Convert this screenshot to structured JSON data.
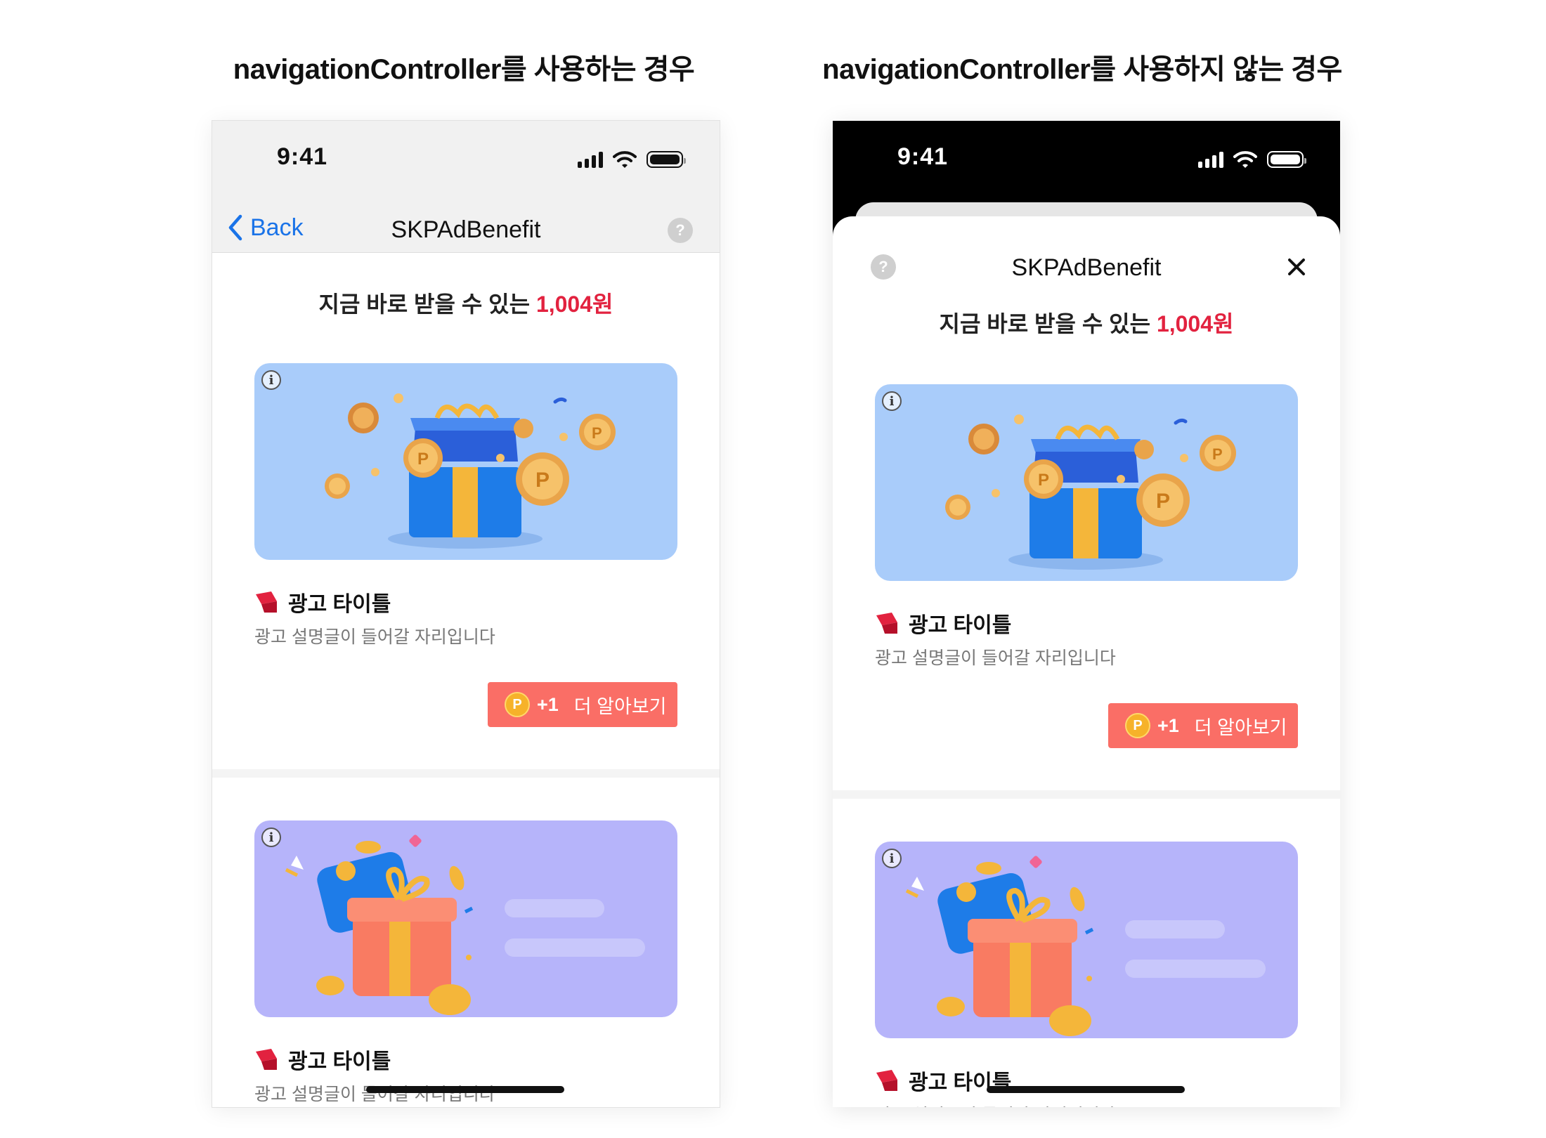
{
  "captions": {
    "left": "navigationController를 사용하는 경우",
    "right": "navigationController를 사용하지 않는 경우"
  },
  "status_bar": {
    "time": "9:41"
  },
  "left_phone": {
    "nav": {
      "back_label": "Back",
      "title": "SKPAdBenefit",
      "help_glyph": "?"
    }
  },
  "right_phone": {
    "sheet": {
      "title": "SKPAdBenefit",
      "help_glyph": "?"
    }
  },
  "headline": {
    "prefix": "지금 바로 받을 수 있는 ",
    "amount": "1,004원"
  },
  "ads": [
    {
      "title": "광고 타이틀",
      "description": "광고 설명글이 들어갈 자리입니다",
      "cta": {
        "coin": "P",
        "reward": "+1",
        "label": "더 알아보기"
      },
      "image_theme": "blue-gift-coins"
    },
    {
      "title": "광고 타이틀",
      "description": "광고 설명글이 들어갈 자리입니다",
      "image_theme": "purple-gift-wallet"
    }
  ],
  "icons": [
    "chevron-left-icon",
    "help-icon",
    "close-icon",
    "info-icon",
    "brand-icon",
    "signal-icon",
    "wifi-icon",
    "battery-icon",
    "point-coin-icon"
  ],
  "colors": {
    "accent_red": "#e2223f",
    "cta_bg": "#fa6e66",
    "back_blue": "#1a73e8",
    "ad_blue": "#a9ccfa",
    "ad_purple": "#b6b4fa"
  }
}
